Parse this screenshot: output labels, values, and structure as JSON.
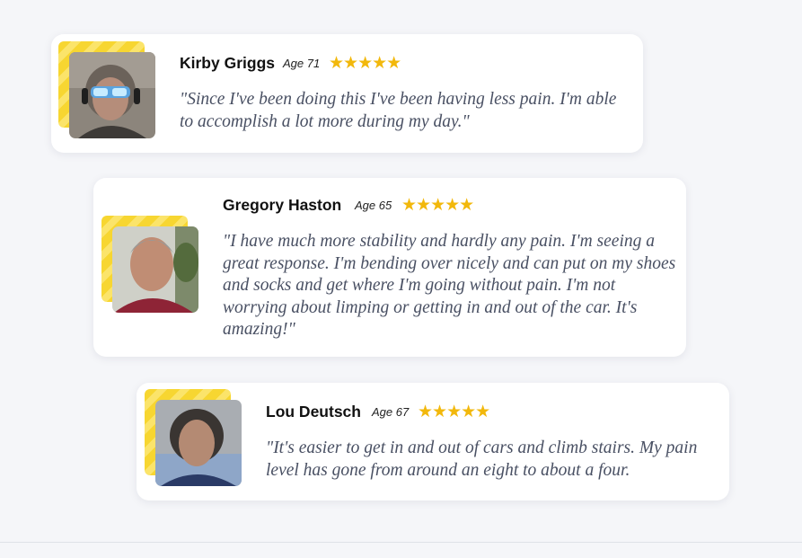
{
  "testimonials": [
    {
      "name": "Kirby Griggs",
      "age": "Age 71",
      "stars": "★★★★★",
      "quote": "\"Since I've been doing this I've been having less pain. I'm able to accomplish a lot more during my day.\""
    },
    {
      "name": "Gregory Haston",
      "age": "Age 65",
      "stars": "★★★★★",
      "quote": "\"I have much more stability and hardly any pain. I'm seeing a great response. I'm bending over nicely and can put on my shoes and socks and get where I'm going without pain. I'm not worrying about limping or getting in and out of the car. It's amazing!\""
    },
    {
      "name": "Lou Deutsch",
      "age": "Age 67",
      "stars": "★★★★★",
      "quote": "\"It's easier to get in and out of cars and climb stairs. My pain level has gone from around an eight to about a four."
    }
  ],
  "rating": {
    "value": 5,
    "max": 5
  },
  "colors": {
    "star": "#f2b80c",
    "accent_yellow": "#f7d631",
    "quote_text": "#495063",
    "card_bg": "#ffffff",
    "page_bg": "#f5f6f9"
  }
}
